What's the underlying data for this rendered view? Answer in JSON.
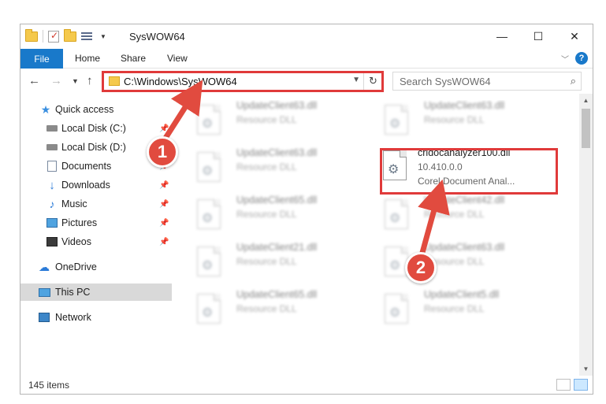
{
  "window": {
    "title": "SysWOW64",
    "controls": {
      "minimize": "—",
      "maximize": "☐",
      "close": "✕"
    }
  },
  "ribbon": {
    "tabs": [
      {
        "label": "File"
      },
      {
        "label": "Home"
      },
      {
        "label": "Share"
      },
      {
        "label": "View"
      }
    ],
    "help": "?"
  },
  "address": {
    "path": "C:\\Windows\\SysWOW64",
    "search_placeholder": "Search SysWOW64"
  },
  "sidebar": {
    "items": [
      {
        "label": "Quick access",
        "icon": "star-icon"
      },
      {
        "label": "Local Disk (C:)",
        "icon": "drive-icon",
        "pinned": true
      },
      {
        "label": "Local Disk (D:)",
        "icon": "drive-icon",
        "pinned": true
      },
      {
        "label": "Documents",
        "icon": "documents-icon",
        "pinned": true
      },
      {
        "label": "Downloads",
        "icon": "download-icon",
        "pinned": true
      },
      {
        "label": "Music",
        "icon": "music-icon",
        "pinned": true
      },
      {
        "label": "Pictures",
        "icon": "pictures-icon",
        "pinned": true
      },
      {
        "label": "Videos",
        "icon": "videos-icon",
        "pinned": true
      },
      {
        "label": "OneDrive",
        "icon": "cloud-icon"
      },
      {
        "label": "This PC",
        "icon": "computer-icon",
        "selected": true
      },
      {
        "label": "Network",
        "icon": "network-icon"
      }
    ]
  },
  "files": [
    {
      "name": "UpdateClient63.dll",
      "type": "Resource DLL"
    },
    {
      "name": "UpdateClient63.dll",
      "type": "Resource DLL"
    },
    {
      "name": "UpdateClient63.dll",
      "type": "Resource DLL"
    },
    {
      "name": "crldocanalyzer100.dll",
      "version": "10.410.0.0",
      "description": "Corel Document Anal...",
      "highlighted": true
    },
    {
      "name": "UpdateClient65.dll",
      "type": "Resource DLL"
    },
    {
      "name": "UpdateClient42.dll",
      "type": "Resource DLL"
    },
    {
      "name": "UpdateClient21.dll",
      "type": "Resource DLL"
    },
    {
      "name": "UpdateClient63.dll",
      "type": "Resource DLL"
    },
    {
      "name": "UpdateClient65.dll",
      "type": "Resource DLL"
    },
    {
      "name": "UpdateClient5.dll",
      "type": "Resource DLL"
    }
  ],
  "status": {
    "item_count": "145 items"
  },
  "callouts": [
    {
      "label": "1"
    },
    {
      "label": "2"
    }
  ],
  "colors": {
    "accent": "#1979ca",
    "highlight": "#e03a3a",
    "badge": "#e14b3f"
  }
}
